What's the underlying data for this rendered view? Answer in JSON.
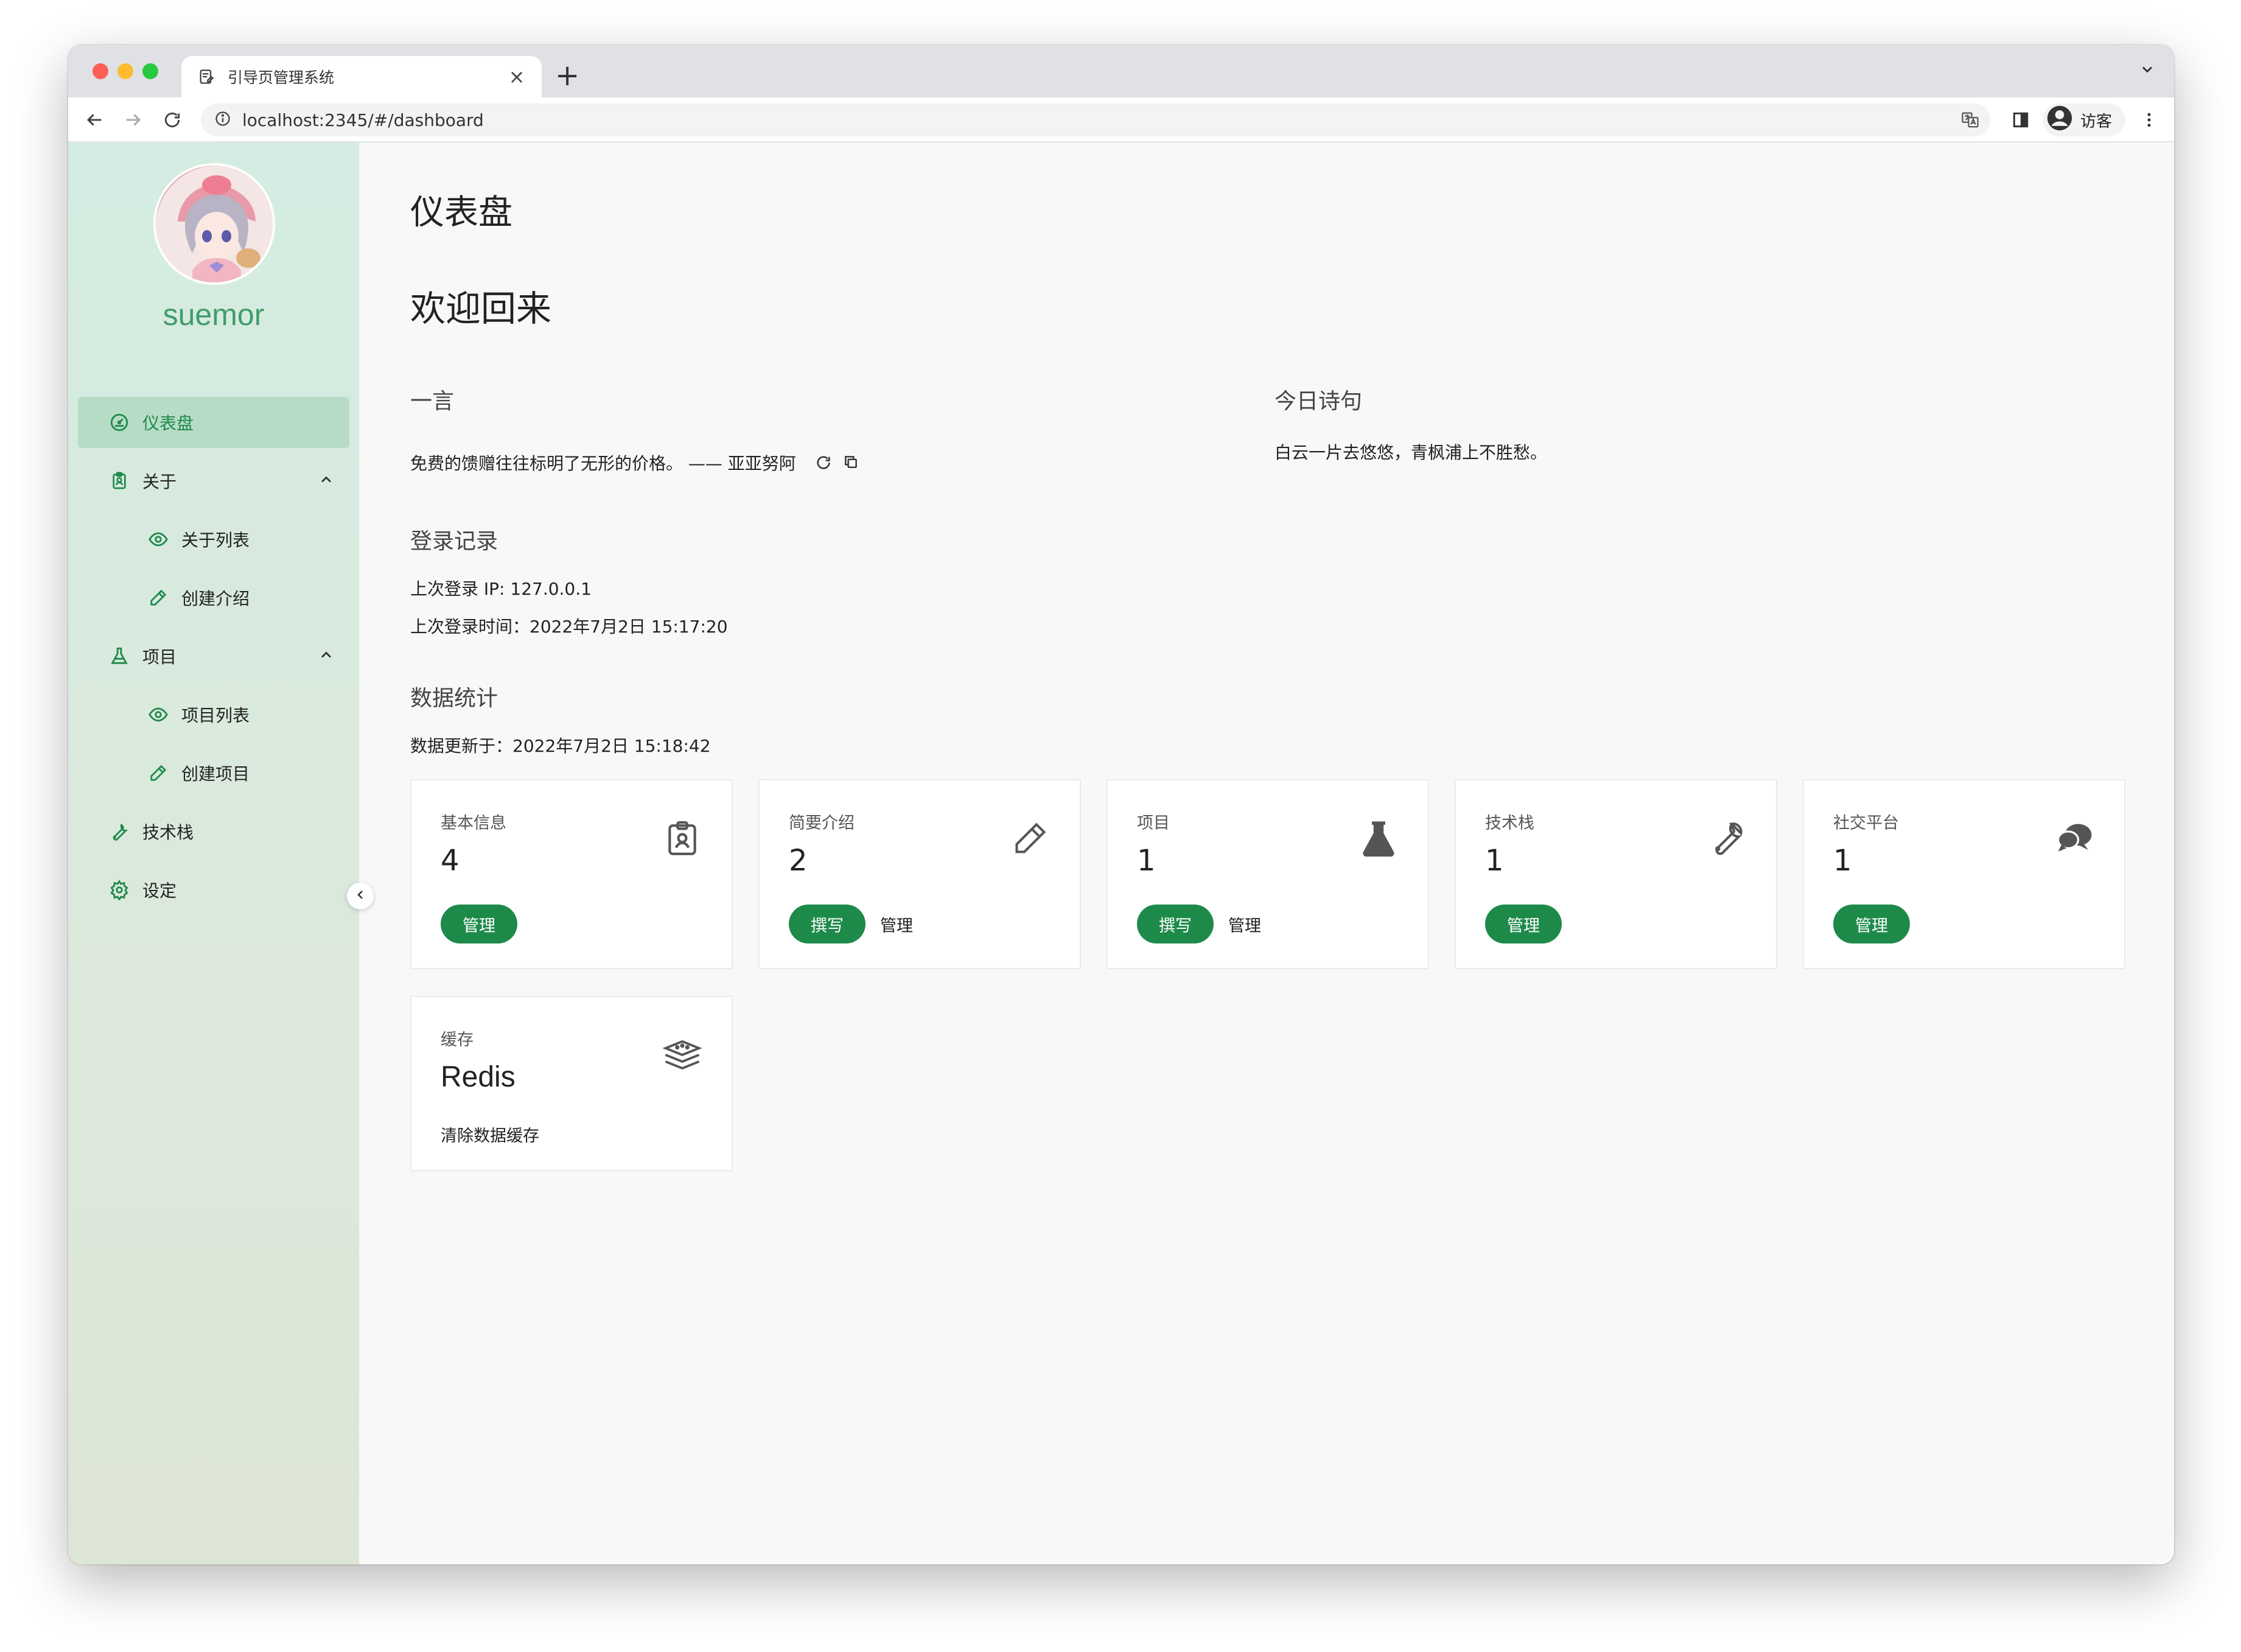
{
  "browser": {
    "tab_title": "引导页管理系统",
    "new_tab_label": "+",
    "close_label": "×",
    "url": "localhost:2345/#/dashboard",
    "profile_label": "访客"
  },
  "sidebar": {
    "username": "suemor",
    "items": [
      {
        "label": "仪表盘",
        "icon": "dashboard-icon",
        "active": true
      },
      {
        "label": "关于",
        "icon": "badge-icon",
        "expanded": true
      },
      {
        "label": "关于列表",
        "icon": "eye-icon",
        "sub": true
      },
      {
        "label": "创建介绍",
        "icon": "pencil-icon",
        "sub": true
      },
      {
        "label": "项目",
        "icon": "flask-icon",
        "expanded": true
      },
      {
        "label": "项目列表",
        "icon": "eye-icon",
        "sub": true
      },
      {
        "label": "创建项目",
        "icon": "pencil-icon",
        "sub": true
      },
      {
        "label": "技术栈",
        "icon": "wrench-icon"
      },
      {
        "label": "设定",
        "icon": "gear-icon"
      }
    ]
  },
  "main": {
    "page_title": "仪表盘",
    "welcome": "欢迎回来",
    "hitokoto": {
      "title": "一言",
      "text": "免费的馈赠往往标明了无形的价格。 —— 亚亚努阿"
    },
    "poem": {
      "title": "今日诗句",
      "text": "白云一片去悠悠，青枫浦上不胜愁。"
    },
    "login": {
      "title": "登录记录",
      "ip": "上次登录 IP: 127.0.0.1",
      "time": "上次登录时间：2022年7月2日 15:17:20"
    },
    "stats": {
      "title": "数据统计",
      "updated": "数据更新于：2022年7月2日 15:18:42",
      "cards": [
        {
          "label": "基本信息",
          "value": "4",
          "icon": "clipboard-badge-icon",
          "primary": "管理",
          "secondary": ""
        },
        {
          "label": "简要介绍",
          "value": "2",
          "icon": "pencil-icon",
          "primary": "撰写",
          "secondary": "管理"
        },
        {
          "label": "项目",
          "value": "1",
          "icon": "flask-icon",
          "primary": "撰写",
          "secondary": "管理"
        },
        {
          "label": "技术栈",
          "value": "1",
          "icon": "wrench-icon",
          "primary": "管理",
          "secondary": ""
        },
        {
          "label": "社交平台",
          "value": "1",
          "icon": "chat-bubbles-icon",
          "primary": "管理",
          "secondary": ""
        }
      ],
      "cache": {
        "label": "缓存",
        "value": "Redis",
        "icon": "layers-icon",
        "action": "清除数据缓存"
      }
    }
  },
  "colors": {
    "accent": "#1e8a4a",
    "username": "#3f9d6a",
    "sidebar_active": "#b7dcc6"
  }
}
